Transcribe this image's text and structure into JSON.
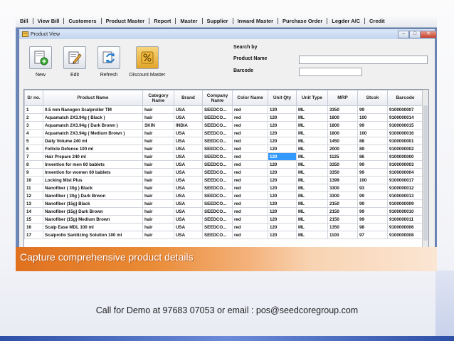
{
  "menu": [
    "Bill",
    "View Bill",
    "Customers",
    "Product Master",
    "Report",
    "Master",
    "Supplier",
    "Inward Master",
    "Purchase Order",
    "Legder A/C",
    "Credit"
  ],
  "window": {
    "title": "Product View",
    "controls": {
      "minimize": "–",
      "maximize": "□",
      "close": "✕"
    }
  },
  "toolbar": {
    "new_label": "New",
    "edit_label": "Edit",
    "refresh_label": "Refresh",
    "discount_label": "Discount Master"
  },
  "search": {
    "title": "Search by",
    "product_name_label": "Product Name",
    "product_name_value": "",
    "barcode_label": "Barcode",
    "barcode_value": ""
  },
  "grid": {
    "columns": [
      "Sr no.",
      "Product Name",
      "Category Name",
      "Brand",
      "Company Name",
      "Color Name",
      "Unit Qty",
      "Unit Type",
      "MRP",
      "Stcok",
      "Barcode"
    ],
    "rows": [
      [
        "1",
        "0.5 mm Nanogen Scalproller TM",
        "hair",
        "USA",
        "SEEDCO...",
        "red",
        "120",
        "ML",
        "3350",
        "99",
        "9100000007"
      ],
      [
        "2",
        "Aquamatch 2X3.94g ( Black )",
        "hair",
        "USA",
        "SEEDCO...",
        "red",
        "120",
        "ML",
        "1800",
        "100",
        "9100000014"
      ],
      [
        "3",
        "Aquamatch 2X3.94g ( Dark Brown )",
        "SKIN",
        "INDIA",
        "SEEDCO...",
        "red",
        "120",
        "ML",
        "1800",
        "99",
        "9100000015"
      ],
      [
        "4",
        "Aquamatch 2X3.94g ( Medium Brown )",
        "hair",
        "USA",
        "SEEDCO...",
        "red",
        "120",
        "ML",
        "1800",
        "100",
        "9100000016"
      ],
      [
        "5",
        "Daily Volume 240 ml",
        "hair",
        "USA",
        "SEEDCO...",
        "red",
        "120",
        "ML",
        "1450",
        "88",
        "9100000001"
      ],
      [
        "6",
        "Follicle Defence 100 ml",
        "hair",
        "USA",
        "SEEDCO...",
        "red",
        "120",
        "ML",
        "2000",
        "89",
        "9100000002"
      ],
      [
        "7",
        "Hair Prepare 240 ml",
        "hair",
        "USA",
        "SEEDCO...",
        "red",
        "120",
        "ML",
        "1125",
        "86",
        "9100000000"
      ],
      [
        "8",
        "Invention for men 60 bablets",
        "hair",
        "USA",
        "SEEDCO...",
        "red",
        "120",
        "ML",
        "3350",
        "99",
        "9100000003"
      ],
      [
        "9",
        "Invention for women 60 bablets",
        "hair",
        "USA",
        "SEEDCO...",
        "red",
        "120",
        "ML",
        "3350",
        "99",
        "9100000004"
      ],
      [
        "10",
        "Locking Mist Plus",
        "hair",
        "USA",
        "SEEDCO...",
        "red",
        "120",
        "ML",
        "1399",
        "100",
        "9100000017"
      ],
      [
        "11",
        "Nanofiber ( 30g ) Black",
        "hair",
        "USA",
        "SEEDCO...",
        "red",
        "120",
        "ML",
        "3300",
        "93",
        "9100000012"
      ],
      [
        "12",
        "Nanofiber ( 30g ) Dark Brwon",
        "hair",
        "USA",
        "SEEDCO...",
        "red",
        "120",
        "ML",
        "3300",
        "99",
        "9100000013"
      ],
      [
        "13",
        "Nanofiber (15g) Black",
        "hair",
        "USA",
        "SEEDCO...",
        "red",
        "120",
        "ML",
        "2150",
        "99",
        "9100000009"
      ],
      [
        "14",
        "Nanofiber (15g) Dark Brown",
        "hair",
        "USA",
        "SEEDCO...",
        "red",
        "120",
        "ML",
        "2150",
        "99",
        "9100000010"
      ],
      [
        "15",
        "Nanofiber (15g) Medium Brown",
        "hair",
        "USA",
        "SEEDCO...",
        "red",
        "120",
        "ML",
        "2150",
        "99",
        "9100000011"
      ],
      [
        "16",
        "Scalp Ease MDL 100 ml",
        "hair",
        "USA",
        "SEEDCO...",
        "red",
        "120",
        "ML",
        "1350",
        "98",
        "9100000006"
      ],
      [
        "17",
        "Scalprollo Sanitizing Solution 100 ml",
        "hair",
        "USA",
        "SEEDCO...",
        "red",
        "120",
        "ML",
        "1100",
        "97",
        "9100000008"
      ]
    ],
    "selected_row": 6,
    "selected_col": 6
  },
  "caption": "Capture comprehensive product details",
  "footer": "Call for Demo at 97683 07053 or email : pos@seedcoregroup.com",
  "colors": {
    "accent": "#3399ff",
    "caption": "#e0711f",
    "frame": "#6b86b8"
  }
}
